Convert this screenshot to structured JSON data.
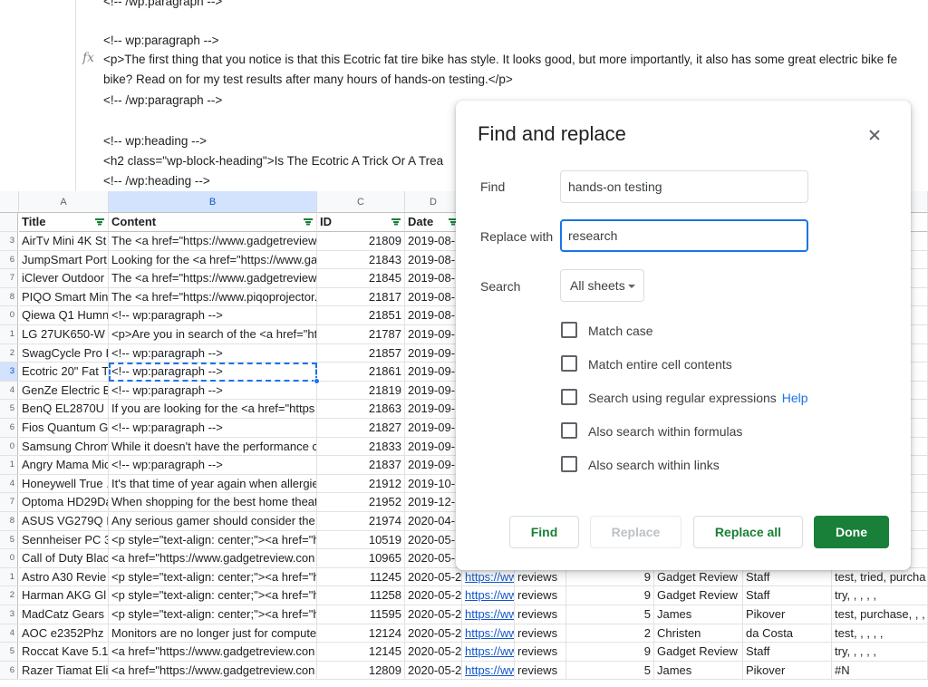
{
  "formula_bar": {
    "fx_label": "fx",
    "lines": [
      "<!-- /wp:paragraph -->",
      "<!-- wp:paragraph -->",
      "<p>The first thing that you notice is that this Ecotric fat tire bike has style. It looks good, but more importantly, it also has some great electric bike fe",
      "bike? Read on for my test results after many hours of hands-on testing.</p>",
      "<!-- /wp:paragraph -->",
      "<!-- wp:heading -->",
      "<h2 class=\"wp-block-heading\">Is The Ecotric A Trick Or A Trea",
      "<!-- /wp:heading -->"
    ]
  },
  "grid": {
    "columns": [
      {
        "letter": "A",
        "header": "Title"
      },
      {
        "letter": "B",
        "header": "Content"
      },
      {
        "letter": "C",
        "header": "ID"
      },
      {
        "letter": "D",
        "header": "Date"
      },
      {
        "letter": "",
        "header": ""
      },
      {
        "letter": "",
        "header": ""
      },
      {
        "letter": "",
        "header": ""
      },
      {
        "letter": "",
        "header": ""
      },
      {
        "letter": "",
        "header": ""
      },
      {
        "letter": "J",
        "header": "ting"
      }
    ],
    "rows": [
      {
        "n": "3",
        "title": "AirTv Mini 4K St",
        "content": "The <a href=\"https://www.gadgetreview",
        "id": "21809",
        "date": "2019-08-",
        "g": "",
        "h": "",
        "i": "",
        "j": "",
        "k": "",
        "l": "#N"
      },
      {
        "n": "6",
        "title": "JumpSmart Port",
        "content": "Looking for the <a href=\"https://www.ga",
        "id": "21843",
        "date": "2019-08-",
        "g": "",
        "h": "",
        "i": "",
        "j": "",
        "k": "",
        "l": "#N"
      },
      {
        "n": "7",
        "title": "iClever Outdoor",
        "content": "The <a href=\"https://www.gadgetreview",
        "id": "21845",
        "date": "2019-08-",
        "g": "",
        "h": "",
        "i": "",
        "j": "",
        "k": "",
        "l": "#N"
      },
      {
        "n": "8",
        "title": "PIQO Smart Min",
        "content": "The <a href=\"https://www.piqoprojector.",
        "id": "21817",
        "date": "2019-08-",
        "g": "",
        "h": "",
        "i": "",
        "j": "",
        "k": "",
        "l": "#N"
      },
      {
        "n": "0",
        "title": "Qiewa Q1 Humn",
        "content": "<!-- wp:paragraph -->",
        "id": "21851",
        "date": "2019-08-",
        "g": "",
        "h": "",
        "i": "",
        "j": "",
        "k": "",
        "l": "#N"
      },
      {
        "n": "1",
        "title": "LG 27UK650-W",
        "content": "<p>Are you in search of the <a href=\"ht",
        "id": "21787",
        "date": "2019-09-",
        "g": "",
        "h": "",
        "i": "",
        "j": "",
        "k": "",
        "l": ","
      },
      {
        "n": "2",
        "title": "SwagCycle Pro I",
        "content": "<!-- wp:paragraph -->",
        "id": "21857",
        "date": "2019-09-",
        "g": "",
        "h": "",
        "i": "",
        "j": "",
        "k": "",
        "l": "#N"
      },
      {
        "n": "3",
        "title": "Ecotric 20\" Fat T",
        "content": "<!-- wp:paragraph -->",
        "id": "21861",
        "date": "2019-09-",
        "g": "",
        "h": "",
        "i": "",
        "j": "",
        "k": "",
        "l": "#N"
      },
      {
        "n": "4",
        "title": "GenZe Electric B",
        "content": "<!-- wp:paragraph -->",
        "id": "21819",
        "date": "2019-09-",
        "g": "",
        "h": "",
        "i": "",
        "j": "",
        "k": "",
        "l": ""
      },
      {
        "n": "5",
        "title": "BenQ EL2870U",
        "content": "If you are looking for the <a href=\"https",
        "id": "21863",
        "date": "2019-09-",
        "g": "",
        "h": "",
        "i": "",
        "j": "",
        "k": "",
        "l": "#N"
      },
      {
        "n": "6",
        "title": "Fios Quantum G",
        "content": "<!-- wp:paragraph -->",
        "id": "21827",
        "date": "2019-09-",
        "g": "",
        "h": "",
        "i": "",
        "j": "",
        "k": "",
        "l": "#N"
      },
      {
        "n": "0",
        "title": "Samsung Chrom",
        "content": "While it doesn't have the performance c",
        "id": "21833",
        "date": "2019-09-",
        "g": "",
        "h": "",
        "i": "",
        "j": "",
        "k": "",
        "l": "#N"
      },
      {
        "n": "1",
        "title": "Angry Mama Mic",
        "content": "<!-- wp:paragraph -->",
        "id": "21837",
        "date": "2019-09-",
        "g": "",
        "h": "",
        "i": "",
        "j": "",
        "k": "",
        "l": ", , ,"
      },
      {
        "n": "4",
        "title": "Honeywell True .",
        "content": "It's that time of year again when allergie",
        "id": "21912",
        "date": "2019-10-",
        "g": "",
        "h": "",
        "i": "",
        "j": "",
        "k": "",
        "l": "#N"
      },
      {
        "n": "7",
        "title": "Optoma HD29Da",
        "content": "When shopping for the best home theat",
        "id": "21952",
        "date": "2019-12-",
        "g": "",
        "h": "",
        "i": "",
        "j": "",
        "k": "",
        "l": "#N"
      },
      {
        "n": "8",
        "title": "ASUS VG279Q I",
        "content": "Any serious gamer should consider the",
        "id": "21974",
        "date": "2020-04-",
        "g": "",
        "h": "",
        "i": "",
        "j": "",
        "k": "",
        "l": "#N"
      },
      {
        "n": "5",
        "title": "Sennheiser PC 3",
        "content": "<p style=\"text-align: center;\"><a href=\"h",
        "id": "10519",
        "date": "2020-05-",
        "g": "",
        "h": "",
        "i": "",
        "j": "",
        "k": "",
        "l": "#N"
      },
      {
        "n": "0",
        "title": "Call of Duty Blac",
        "content": "<a href=\"https://www.gadgetreview.con",
        "id": "10965",
        "date": "2020-05-",
        "g": "",
        "h": "",
        "i": "",
        "j": "",
        "k": "",
        "l": "ase"
      },
      {
        "n": "1",
        "title": "Astro A30 Revie",
        "content": "<p style=\"text-align: center;\"><a href=\"h",
        "id": "11245",
        "date": "2020-05-2",
        "g": "https://ww",
        "h": "reviews",
        "i": "9",
        "j": "Gadget Review",
        "k": "Staff",
        "l": "test, tried, purcha"
      },
      {
        "n": "2",
        "title": "Harman AKG Gl",
        "content": "<p style=\"text-align: center;\"><a href=\"h",
        "id": "11258",
        "date": "2020-05-2",
        "g": "https://ww",
        "h": "reviews",
        "i": "9",
        "j": "Gadget Review",
        "k": "Staff",
        "l": "try, , , , ,"
      },
      {
        "n": "3",
        "title": "MadCatz Gears",
        "content": "<p style=\"text-align: center;\"><a href=\"h",
        "id": "11595",
        "date": "2020-05-2",
        "g": "https://ww",
        "h": "reviews",
        "i": "5",
        "j": "James",
        "k": "Pikover",
        "l": "test, purchase, , ,"
      },
      {
        "n": "4",
        "title": "AOC e2352Phz",
        "content": "Monitors are no longer just for compute",
        "id": "12124",
        "date": "2020-05-2",
        "g": "https://ww",
        "h": "reviews",
        "i": "2",
        "j": "Christen",
        "k": "da Costa",
        "l": "test, , , , ,"
      },
      {
        "n": "5",
        "title": "Roccat Kave 5.1",
        "content": "<a href=\"https://www.gadgetreview.con",
        "id": "12145",
        "date": "2020-05-2",
        "g": "https://ww",
        "h": "reviews",
        "i": "9",
        "j": "Gadget Review",
        "k": "Staff",
        "l": "try, , , , ,"
      },
      {
        "n": "6",
        "title": "Razer Tiamat Eli",
        "content": "<a href=\"https://www.gadgetreview.con",
        "id": "12809",
        "date": "2020-05-2",
        "g": "https://ww",
        "h": "reviews",
        "i": "5",
        "j": "James",
        "k": "Pikover",
        "l": "#N"
      }
    ]
  },
  "dialog": {
    "title": "Find and replace",
    "find_label": "Find",
    "find_value": "hands-on testing",
    "replace_label": "Replace with",
    "replace_value": "research",
    "search_label": "Search",
    "search_scope": "All sheets",
    "options": [
      {
        "label": "Match case",
        "checked": false
      },
      {
        "label": "Match entire cell contents",
        "checked": false
      },
      {
        "label": "Search using regular expressions",
        "checked": false
      },
      {
        "label": "Also search within formulas",
        "checked": false
      },
      {
        "label": "Also search within links",
        "checked": false
      }
    ],
    "help_link": "Help",
    "buttons": {
      "find": "Find",
      "replace": "Replace",
      "replace_all": "Replace all",
      "done": "Done"
    }
  },
  "colors": {
    "accent_green": "#188038",
    "focus_blue": "#1a73e8",
    "link_blue": "#1155cc"
  }
}
